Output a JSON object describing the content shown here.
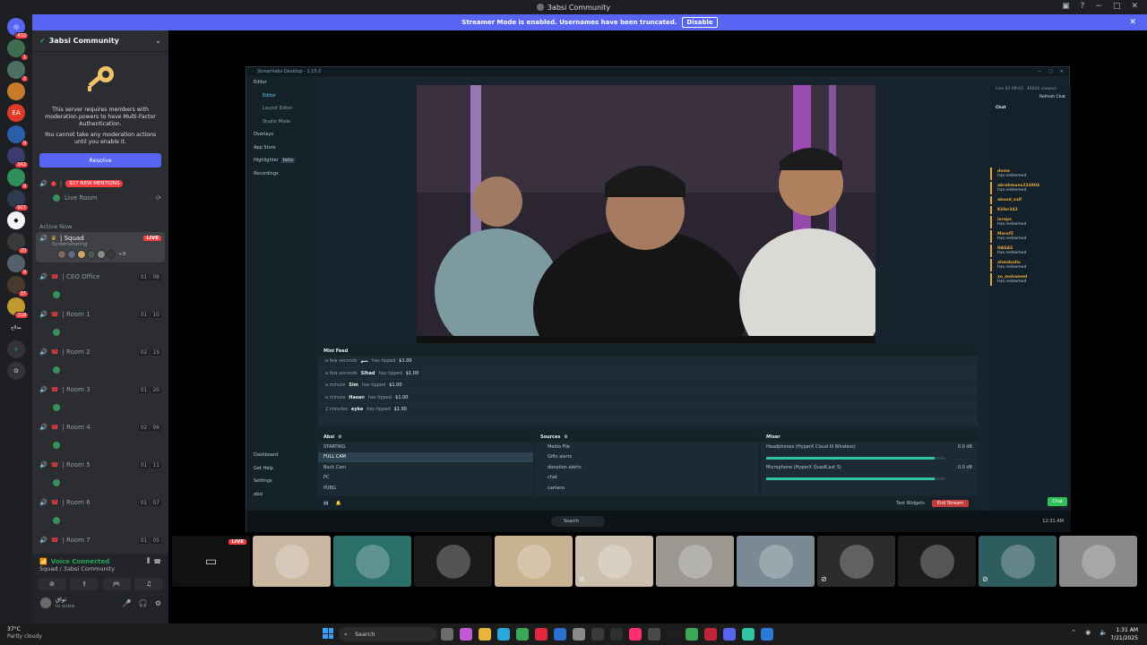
{
  "window": {
    "title": "3absi Community",
    "controls": [
      "−",
      "□",
      "✕"
    ]
  },
  "streamer_banner": {
    "text": "Streamer Mode is enabled. Usernames have been truncated.",
    "button": "Disable"
  },
  "server_rail": {
    "badges": [
      "432",
      "1",
      "2",
      "",
      "",
      "9",
      "342",
      "9",
      "927",
      "",
      "20",
      "9",
      "37",
      "318",
      "مدلاج",
      "",
      ""
    ]
  },
  "server": {
    "name": "3absi Community",
    "mfa_message": "This server requires members with moderation powers to have Multi-Factor Authentication.",
    "mfa_sub": "You cannot take any moderation actions until you enable it.",
    "resolve_label": "Resolve",
    "mentions_badge": "927 NEW MENTIONS",
    "live_room": "Live Room",
    "active_now_label": "Active Now",
    "channels": [
      {
        "name": "| Squad",
        "sub": "Screensharing",
        "live": "LIVE",
        "extra": "+9"
      },
      {
        "name": "| CEO Office",
        "count_a": "01",
        "count_b": "08"
      },
      {
        "name": "| Room 1",
        "count_a": "01",
        "count_b": "10"
      },
      {
        "name": "| Room 2",
        "count_a": "02",
        "count_b": "15"
      },
      {
        "name": "| Room 3",
        "count_a": "01",
        "count_b": "20"
      },
      {
        "name": "| Room 4",
        "count_a": "02",
        "count_b": "99"
      },
      {
        "name": "| Room 5",
        "count_a": "01",
        "count_b": "11"
      },
      {
        "name": "| Room 6",
        "count_a": "01",
        "count_b": "07"
      },
      {
        "name": "| Room 7",
        "count_a": "01",
        "count_b": "05"
      }
    ]
  },
  "voice": {
    "status": "Voice Connected",
    "location": "Squad / 3absi Community",
    "user_name": "ثواق",
    "user_status": "In voice"
  },
  "obs": {
    "title": "Streamlabs Desktop - 1.15.0",
    "sidebar": [
      "Editor",
      "Editor",
      "Layout Editor",
      "Studio Mode",
      "Overlays",
      "App Store",
      "Highlighter",
      "Recordings"
    ],
    "sidebar_badge": "beta",
    "sidebar_bottom": [
      "Dashboard",
      "Get Help",
      "Settings",
      "absi"
    ],
    "mini_feed_title": "Mini Feed",
    "feed": [
      {
        "time": "a few seconds",
        "user": "منو",
        "action": "has tipped",
        "amount": "$1.00"
      },
      {
        "time": "a few seconds",
        "user": "Sihad",
        "action": "has tipped",
        "amount": "$1.00"
      },
      {
        "time": "a minute",
        "user": "Sim",
        "action": "has tipped",
        "amount": "$1.00"
      },
      {
        "time": "a minute",
        "user": "Hasan",
        "action": "has tipped",
        "amount": "$1.00"
      },
      {
        "time": "2 minutes",
        "user": "eyke",
        "action": "has tipped",
        "amount": "$1.00"
      }
    ],
    "scenes_title": "Absi",
    "scenes": [
      "STARTING",
      "FULL CAM",
      "Back Cam",
      "PC",
      "PUBG"
    ],
    "sources_title": "Sources",
    "sources": [
      "Media File",
      "Gifts alerts",
      "donation alerts",
      "chat",
      "camera"
    ],
    "mixer_title": "Mixer",
    "mixer": [
      {
        "name": "Headphones (HyperX Cloud III Wireless)",
        "db": "0.0 dB",
        "level": 0.94
      },
      {
        "name": "Microphone (HyperX QuadCast S)",
        "db": "0.0 dB",
        "level": 0.94
      }
    ],
    "test_widgets": "Test Widgets",
    "end_stream": "End Stream",
    "live_timer": "Live 02:09:03",
    "viewers": "40016 viewers",
    "refresh_chat": "Refresh Chat",
    "chat_title": "Chat",
    "chat_messages": [
      {
        "user": "dome",
        "text": "has redeemed"
      },
      {
        "user": "abrahmans224904",
        "text": "has redeemed"
      },
      {
        "user": "abood_saif",
        "text": ""
      },
      {
        "user": "Killer342",
        "text": ""
      },
      {
        "user": "ioreps",
        "text": "has redeemed"
      },
      {
        "user": "Marof5",
        "text": "has redeemed"
      },
      {
        "user": "HASAS",
        "text": "has redeemed"
      },
      {
        "user": "ahmdsalls",
        "text": "has redeemed"
      },
      {
        "user": "xo_mohamed",
        "text": "has redeemed"
      }
    ],
    "chat_button": "Chat",
    "taskbar_search": "Search",
    "obs_clock": "12:31 AM"
  },
  "tiles": [
    {
      "kind": "stream",
      "live": "LIVE",
      "color": "#3a3f45"
    },
    {
      "kind": "avatar",
      "color": "#c9b7a2"
    },
    {
      "kind": "avatar",
      "color": "#2b6f6b"
    },
    {
      "kind": "avatar",
      "color": "#1a1a1a"
    },
    {
      "kind": "avatar",
      "color": "#c9b28f"
    },
    {
      "kind": "avatar",
      "color": "#cdbfae"
    },
    {
      "kind": "avatar",
      "color": "#9b9892"
    },
    {
      "kind": "avatar",
      "color": "#7a8a95"
    },
    {
      "kind": "avatar",
      "color": "#2c2c2c"
    },
    {
      "kind": "avatar",
      "color": "#1c1c1c"
    },
    {
      "kind": "avatar",
      "color": "#2f5d5f"
    },
    {
      "kind": "avatar",
      "color": "#8a8a8a"
    }
  ],
  "taskbar": {
    "temp": "37°C",
    "weather": "Partly cloudy",
    "search": "Search",
    "time": "1:31 AM",
    "date": "7/21/2025"
  }
}
